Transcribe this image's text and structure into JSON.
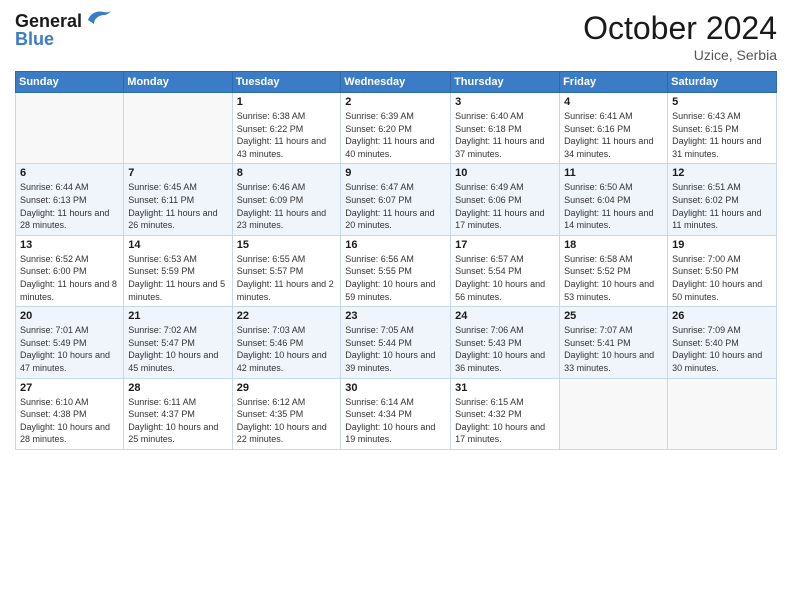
{
  "logo": {
    "line1": "General",
    "line2": "Blue"
  },
  "title": "October 2024",
  "location": "Uzice, Serbia",
  "weekdays": [
    "Sunday",
    "Monday",
    "Tuesday",
    "Wednesday",
    "Thursday",
    "Friday",
    "Saturday"
  ],
  "weeks": [
    [
      {
        "day": "",
        "detail": ""
      },
      {
        "day": "",
        "detail": ""
      },
      {
        "day": "1",
        "detail": "Sunrise: 6:38 AM\nSunset: 6:22 PM\nDaylight: 11 hours and 43 minutes."
      },
      {
        "day": "2",
        "detail": "Sunrise: 6:39 AM\nSunset: 6:20 PM\nDaylight: 11 hours and 40 minutes."
      },
      {
        "day": "3",
        "detail": "Sunrise: 6:40 AM\nSunset: 6:18 PM\nDaylight: 11 hours and 37 minutes."
      },
      {
        "day": "4",
        "detail": "Sunrise: 6:41 AM\nSunset: 6:16 PM\nDaylight: 11 hours and 34 minutes."
      },
      {
        "day": "5",
        "detail": "Sunrise: 6:43 AM\nSunset: 6:15 PM\nDaylight: 11 hours and 31 minutes."
      }
    ],
    [
      {
        "day": "6",
        "detail": "Sunrise: 6:44 AM\nSunset: 6:13 PM\nDaylight: 11 hours and 28 minutes."
      },
      {
        "day": "7",
        "detail": "Sunrise: 6:45 AM\nSunset: 6:11 PM\nDaylight: 11 hours and 26 minutes."
      },
      {
        "day": "8",
        "detail": "Sunrise: 6:46 AM\nSunset: 6:09 PM\nDaylight: 11 hours and 23 minutes."
      },
      {
        "day": "9",
        "detail": "Sunrise: 6:47 AM\nSunset: 6:07 PM\nDaylight: 11 hours and 20 minutes."
      },
      {
        "day": "10",
        "detail": "Sunrise: 6:49 AM\nSunset: 6:06 PM\nDaylight: 11 hours and 17 minutes."
      },
      {
        "day": "11",
        "detail": "Sunrise: 6:50 AM\nSunset: 6:04 PM\nDaylight: 11 hours and 14 minutes."
      },
      {
        "day": "12",
        "detail": "Sunrise: 6:51 AM\nSunset: 6:02 PM\nDaylight: 11 hours and 11 minutes."
      }
    ],
    [
      {
        "day": "13",
        "detail": "Sunrise: 6:52 AM\nSunset: 6:00 PM\nDaylight: 11 hours and 8 minutes."
      },
      {
        "day": "14",
        "detail": "Sunrise: 6:53 AM\nSunset: 5:59 PM\nDaylight: 11 hours and 5 minutes."
      },
      {
        "day": "15",
        "detail": "Sunrise: 6:55 AM\nSunset: 5:57 PM\nDaylight: 11 hours and 2 minutes."
      },
      {
        "day": "16",
        "detail": "Sunrise: 6:56 AM\nSunset: 5:55 PM\nDaylight: 10 hours and 59 minutes."
      },
      {
        "day": "17",
        "detail": "Sunrise: 6:57 AM\nSunset: 5:54 PM\nDaylight: 10 hours and 56 minutes."
      },
      {
        "day": "18",
        "detail": "Sunrise: 6:58 AM\nSunset: 5:52 PM\nDaylight: 10 hours and 53 minutes."
      },
      {
        "day": "19",
        "detail": "Sunrise: 7:00 AM\nSunset: 5:50 PM\nDaylight: 10 hours and 50 minutes."
      }
    ],
    [
      {
        "day": "20",
        "detail": "Sunrise: 7:01 AM\nSunset: 5:49 PM\nDaylight: 10 hours and 47 minutes."
      },
      {
        "day": "21",
        "detail": "Sunrise: 7:02 AM\nSunset: 5:47 PM\nDaylight: 10 hours and 45 minutes."
      },
      {
        "day": "22",
        "detail": "Sunrise: 7:03 AM\nSunset: 5:46 PM\nDaylight: 10 hours and 42 minutes."
      },
      {
        "day": "23",
        "detail": "Sunrise: 7:05 AM\nSunset: 5:44 PM\nDaylight: 10 hours and 39 minutes."
      },
      {
        "day": "24",
        "detail": "Sunrise: 7:06 AM\nSunset: 5:43 PM\nDaylight: 10 hours and 36 minutes."
      },
      {
        "day": "25",
        "detail": "Sunrise: 7:07 AM\nSunset: 5:41 PM\nDaylight: 10 hours and 33 minutes."
      },
      {
        "day": "26",
        "detail": "Sunrise: 7:09 AM\nSunset: 5:40 PM\nDaylight: 10 hours and 30 minutes."
      }
    ],
    [
      {
        "day": "27",
        "detail": "Sunrise: 6:10 AM\nSunset: 4:38 PM\nDaylight: 10 hours and 28 minutes."
      },
      {
        "day": "28",
        "detail": "Sunrise: 6:11 AM\nSunset: 4:37 PM\nDaylight: 10 hours and 25 minutes."
      },
      {
        "day": "29",
        "detail": "Sunrise: 6:12 AM\nSunset: 4:35 PM\nDaylight: 10 hours and 22 minutes."
      },
      {
        "day": "30",
        "detail": "Sunrise: 6:14 AM\nSunset: 4:34 PM\nDaylight: 10 hours and 19 minutes."
      },
      {
        "day": "31",
        "detail": "Sunrise: 6:15 AM\nSunset: 4:32 PM\nDaylight: 10 hours and 17 minutes."
      },
      {
        "day": "",
        "detail": ""
      },
      {
        "day": "",
        "detail": ""
      }
    ]
  ]
}
